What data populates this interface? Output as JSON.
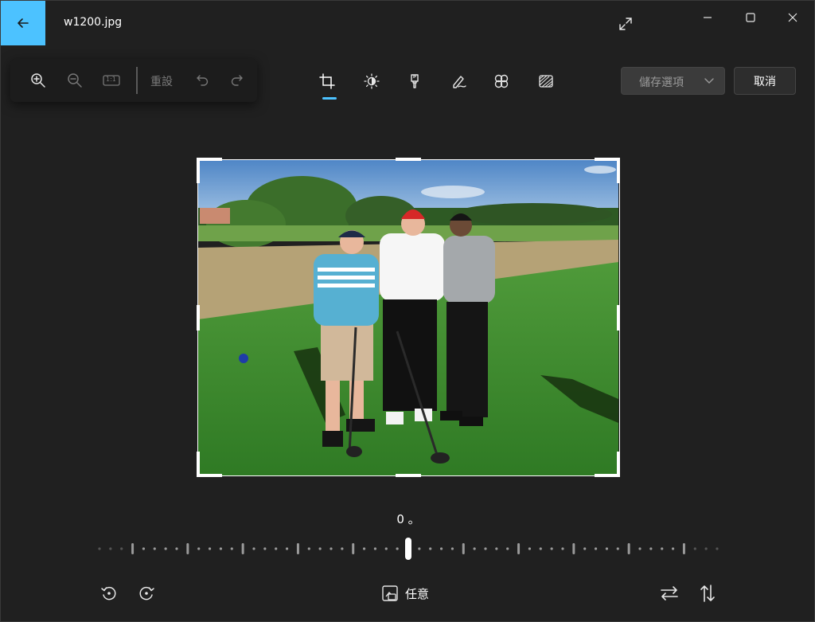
{
  "window": {
    "title": "w1200.jpg"
  },
  "zoom_toolbar": {
    "zoom_in": "zoom-in-icon",
    "zoom_out": "zoom-out-icon",
    "actual_size": "1:1",
    "reset_label": "重設",
    "undo": "undo-icon",
    "redo": "redo-icon"
  },
  "edit_tools": [
    {
      "name": "crop",
      "icon": "crop-icon",
      "active": true
    },
    {
      "name": "adjust",
      "icon": "brightness-icon",
      "active": false
    },
    {
      "name": "filter",
      "icon": "filter-icon",
      "active": false
    },
    {
      "name": "markup",
      "icon": "markup-pen-icon",
      "active": false
    },
    {
      "name": "retouch",
      "icon": "retouch-icon",
      "active": false
    },
    {
      "name": "background",
      "icon": "background-blur-icon",
      "active": false
    }
  ],
  "actions": {
    "save_options_label": "儲存選項",
    "cancel_label": "取消"
  },
  "rotation": {
    "angle_text": "0 。",
    "angle_value": 0,
    "range": [
      -45,
      45
    ]
  },
  "bottom_toolbar": {
    "aspect_label": "任意"
  },
  "colors": {
    "accent": "#4cc2ff",
    "background": "#202020",
    "surface": "#1c1c1c"
  }
}
